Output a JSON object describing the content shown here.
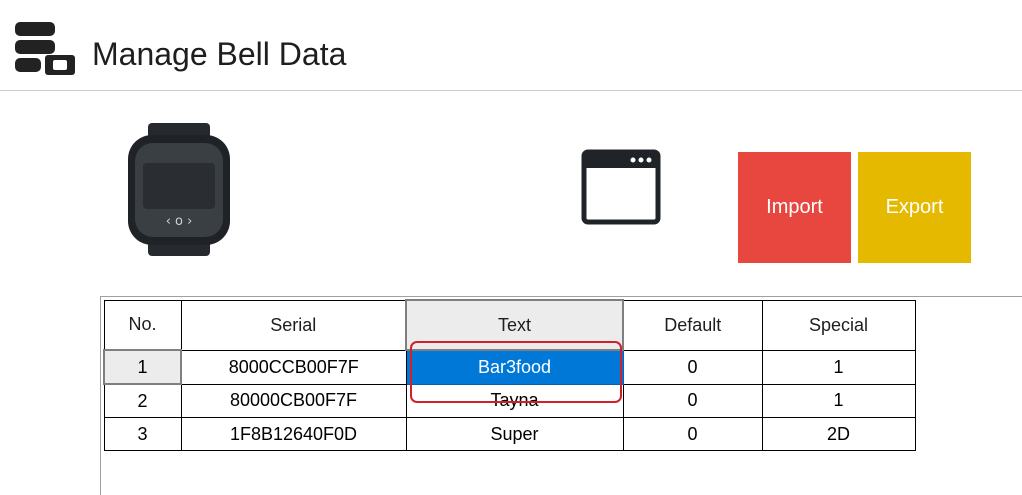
{
  "header": {
    "title": "Manage Bell Data",
    "icon": "database-settings-icon"
  },
  "toolbar": {
    "device_icon": "bell-device-icon",
    "window_icon": "window-icon",
    "import_label": "Import",
    "export_label": "Export",
    "import_color": "#e8473f",
    "export_color": "#e5b900"
  },
  "grid": {
    "columns": [
      "No.",
      "Serial",
      "Text",
      "Default",
      "Special"
    ],
    "active_column": "Text",
    "rows": [
      [
        "1",
        "8000CCB00F7F",
        "Bar3food",
        "0",
        "1"
      ],
      [
        "2",
        "80000CB00F7F",
        "Tayna",
        "0",
        "1"
      ],
      [
        "3",
        "1F8B12640F0D",
        "Super",
        "0",
        "2D"
      ]
    ],
    "selected_cell": {
      "row": 1,
      "column": "Text"
    },
    "selection_color": "#0078d7",
    "highlight_color": "#d21f2a"
  }
}
